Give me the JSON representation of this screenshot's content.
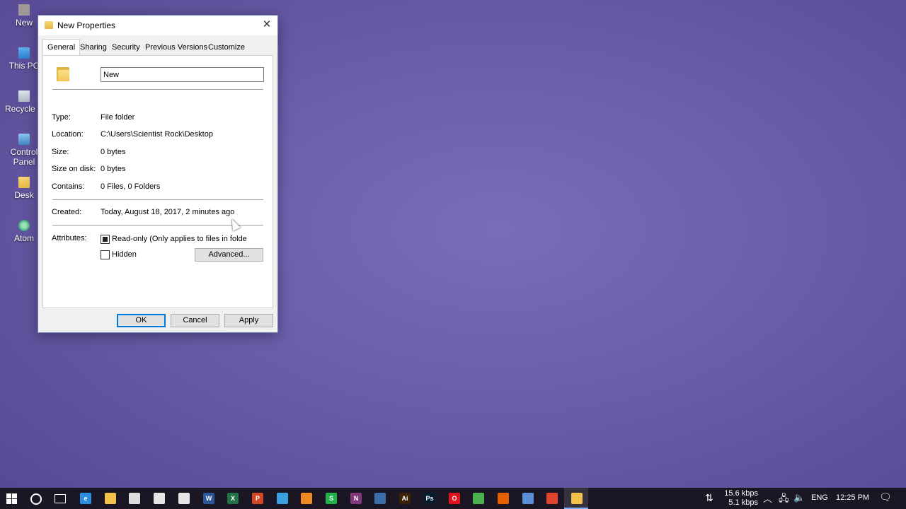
{
  "desktop": {
    "icons": [
      {
        "label": "New"
      },
      {
        "label": "This PC"
      },
      {
        "label": "Recycle B"
      },
      {
        "label": "Control Panel"
      },
      {
        "label": "Desk"
      },
      {
        "label": "Atom"
      }
    ]
  },
  "dialog": {
    "title": "New Properties",
    "close_symbol": "✕",
    "tabs": [
      {
        "label": "General",
        "active": true
      },
      {
        "label": "Sharing"
      },
      {
        "label": "Security"
      },
      {
        "label": "Previous Versions"
      },
      {
        "label": "Customize"
      }
    ],
    "folder_name": "New",
    "rows": [
      {
        "label": "Type:",
        "value": "File folder"
      },
      {
        "label": "Location:",
        "value": "C:\\Users\\Scientist Rock\\Desktop"
      },
      {
        "label": "Size:",
        "value": "0 bytes"
      },
      {
        "label": "Size on disk:",
        "value": "0 bytes"
      },
      {
        "label": "Contains:",
        "value": "0 Files, 0 Folders"
      }
    ],
    "created": {
      "label": "Created:",
      "value": "Today, August 18, 2017, 2 minutes ago"
    },
    "attributes": {
      "label": "Attributes:",
      "readonly_label": "Read-only (Only applies to files in folde",
      "readonly_state": "indeterminate",
      "hidden_label": "Hidden",
      "hidden_checked": false,
      "advanced_button": "Advanced..."
    },
    "buttons": {
      "ok": "OK",
      "cancel": "Cancel",
      "apply": "Apply"
    }
  },
  "taskbar": {
    "apps": [
      {
        "icon": "edge-icon",
        "color": "#2a8ee0",
        "glyph": "e"
      },
      {
        "icon": "file-explorer-icon",
        "color": "#f3c24a",
        "glyph": ""
      },
      {
        "icon": "store-icon",
        "color": "#dddddd",
        "glyph": ""
      },
      {
        "icon": "calculator-icon",
        "color": "#e6e6e6",
        "glyph": ""
      },
      {
        "icon": "mail-icon",
        "color": "#e6e6e6",
        "glyph": ""
      },
      {
        "icon": "word-icon",
        "color": "#2b579a",
        "glyph": "W"
      },
      {
        "icon": "excel-icon",
        "color": "#217346",
        "glyph": "X"
      },
      {
        "icon": "powerpoint-icon",
        "color": "#d24726",
        "glyph": "P"
      },
      {
        "icon": "app-blue-icon",
        "color": "#3aa0e0",
        "glyph": ""
      },
      {
        "icon": "app-orange-icon",
        "color": "#f08a24",
        "glyph": ""
      },
      {
        "icon": "app-green-icon",
        "color": "#22b24c",
        "glyph": "S"
      },
      {
        "icon": "onenote-icon",
        "color": "#80397b",
        "glyph": "N"
      },
      {
        "icon": "app-dark-icon",
        "color": "#3b6ea8",
        "glyph": ""
      },
      {
        "icon": "illustrator-icon",
        "color": "#3a2304",
        "glyph": "Ai"
      },
      {
        "icon": "photoshop-icon",
        "color": "#001d34",
        "glyph": "Ps"
      },
      {
        "icon": "opera-icon",
        "color": "#e0131e",
        "glyph": "O"
      },
      {
        "icon": "chrome-icon",
        "color": "#4caf50",
        "glyph": ""
      },
      {
        "icon": "firefox-icon",
        "color": "#e66000",
        "glyph": ""
      },
      {
        "icon": "app-globe-icon",
        "color": "#5a8fd8",
        "glyph": ""
      },
      {
        "icon": "app-red-icon",
        "color": "#e2452f",
        "glyph": ""
      },
      {
        "icon": "folder-active-icon",
        "color": "#f3c24a",
        "glyph": ""
      }
    ],
    "net_down": "15.6 kbps",
    "net_up": "5.1 kbps",
    "language": "ENG",
    "time": "12:25 PM"
  }
}
